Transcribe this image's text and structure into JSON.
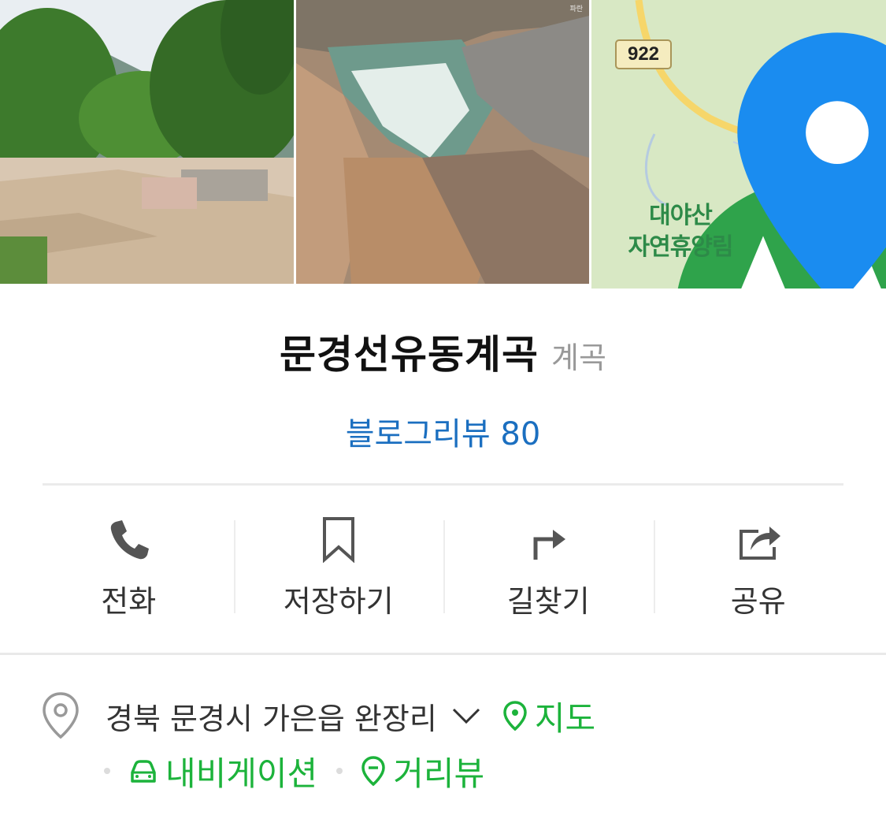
{
  "map": {
    "road_number": "922",
    "poi_label_line1": "대야산",
    "poi_label_line2": "자연휴양림"
  },
  "place": {
    "name": "문경선유동계곡",
    "category": "계곡",
    "review_label": "블로그리뷰",
    "review_count": "80"
  },
  "actions": [
    {
      "label": "전화",
      "icon": "phone-icon"
    },
    {
      "label": "저장하기",
      "icon": "bookmark-icon"
    },
    {
      "label": "길찾기",
      "icon": "directions-icon"
    },
    {
      "label": "공유",
      "icon": "share-icon"
    }
  ],
  "address": {
    "text": "경북 문경시 가은읍 완장리",
    "map_link": "지도",
    "navigation_link": "내비게이션",
    "streetview_link": "거리뷰"
  },
  "colors": {
    "link_blue": "#1b6fc0",
    "link_green": "#1cb33b",
    "map_pin_blue": "#1a8cf0",
    "text_gray": "#999999"
  }
}
